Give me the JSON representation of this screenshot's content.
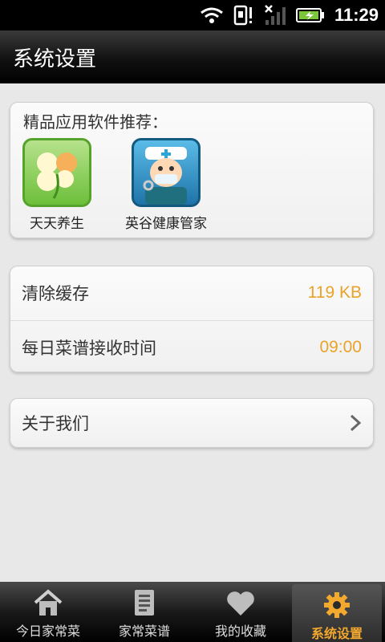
{
  "status_bar": {
    "time": "11:29"
  },
  "header": {
    "title": "系统设置"
  },
  "recommend": {
    "title": "精品应用软件推荐：",
    "apps": [
      {
        "label": "天天养生",
        "icon": "clover-icon"
      },
      {
        "label": "英谷健康管家",
        "icon": "doctor-icon"
      }
    ]
  },
  "settings": {
    "clear_cache": {
      "label": "清除缓存",
      "value": "119 KB"
    },
    "receive_time": {
      "label": "每日菜谱接收时间",
      "value": "09:00"
    }
  },
  "about": {
    "label": "关于我们"
  },
  "tabs": [
    {
      "label": "今日家常菜",
      "icon": "home-icon",
      "active": false
    },
    {
      "label": "家常菜谱",
      "icon": "document-icon",
      "active": false
    },
    {
      "label": "我的收藏",
      "icon": "heart-icon",
      "active": false
    },
    {
      "label": "系统设置",
      "icon": "gear-icon",
      "active": true
    }
  ],
  "colors": {
    "accent": "#f3a82e",
    "value_text": "#e9a32a"
  }
}
